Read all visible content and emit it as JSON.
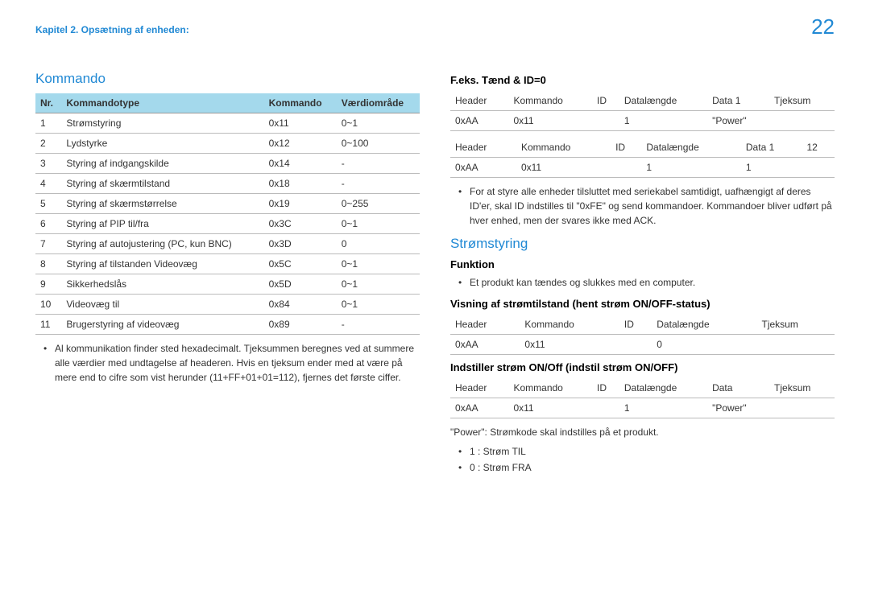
{
  "chapter": "Kapitel 2. Opsætning af enheden:",
  "pageNumber": "22",
  "left": {
    "title": "Kommando",
    "headers": [
      "Nr.",
      "Kommandotype",
      "Kommando",
      "Værdiområde"
    ],
    "rows": [
      [
        "1",
        "Strømstyring",
        "0x11",
        "0~1"
      ],
      [
        "2",
        "Lydstyrke",
        "0x12",
        "0~100"
      ],
      [
        "3",
        "Styring af indgangskilde",
        "0x14",
        "-"
      ],
      [
        "4",
        "Styring af skærmtilstand",
        "0x18",
        "-"
      ],
      [
        "5",
        "Styring af skærmstørrelse",
        "0x19",
        "0~255"
      ],
      [
        "6",
        "Styring af PIP til/fra",
        "0x3C",
        "0~1"
      ],
      [
        "7",
        "Styring af autojustering (PC, kun BNC)",
        "0x3D",
        "0"
      ],
      [
        "8",
        "Styring af tilstanden Videovæg",
        "0x5C",
        "0~1"
      ],
      [
        "9",
        "Sikkerhedslås",
        "0x5D",
        "0~1"
      ],
      [
        "10",
        "Videovæg til",
        "0x84",
        "0~1"
      ],
      [
        "11",
        "Brugerstyring af videovæg",
        "0x89",
        "-"
      ]
    ],
    "note": "Al kommunikation finder sted hexadecimalt. Tjeksummen beregnes ved at summere alle værdier med undtagelse af headeren. Hvis en tjeksum ender med at være på mere end to cifre som vist herunder (11+FF+01+01=112), fjernes det første ciffer."
  },
  "right": {
    "ex1": {
      "title": "F.eks. Tænd & ID=0",
      "t1h": [
        "Header",
        "Kommando",
        "ID",
        "Datalængde",
        "Data 1",
        "Tjeksum"
      ],
      "t1r": [
        "0xAA",
        "0x11",
        "",
        "1",
        "\"Power\"",
        ""
      ],
      "t2h": [
        "Header",
        "Kommando",
        "ID",
        "Datalængde",
        "Data 1",
        "12"
      ],
      "t2r": [
        "0xAA",
        "0x11",
        "",
        "1",
        "1",
        ""
      ],
      "note": "For at styre alle enheder tilsluttet med seriekabel samtidigt, uafhængigt af deres ID'er, skal ID indstilles til \"0xFE\" og send kommandoer. Kommandoer bliver udført på hver enhed, men der svares ikke med ACK."
    },
    "power": {
      "title": "Strømstyring",
      "funcLabel": "Funktion",
      "funcNote": "Et produkt kan tændes og slukkes med en computer.",
      "viewTitle": "Visning af strømtilstand (hent strøm ON/OFF-status)",
      "viewH": [
        "Header",
        "Kommando",
        "ID",
        "Datalængde",
        "Tjeksum"
      ],
      "viewR": [
        "0xAA",
        "0x11",
        "",
        "0",
        ""
      ],
      "setTitle": "Indstiller strøm ON/Off (indstil strøm ON/OFF)",
      "setH": [
        "Header",
        "Kommando",
        "ID",
        "Datalængde",
        "Data",
        "Tjeksum"
      ],
      "setR": [
        "0xAA",
        "0x11",
        "",
        "1",
        "\"Power\"",
        ""
      ],
      "powerDesc": "\"Power\": Strømkode skal indstilles på et produkt.",
      "codes": [
        "1 : Strøm TIL",
        "0 : Strøm FRA"
      ]
    }
  }
}
